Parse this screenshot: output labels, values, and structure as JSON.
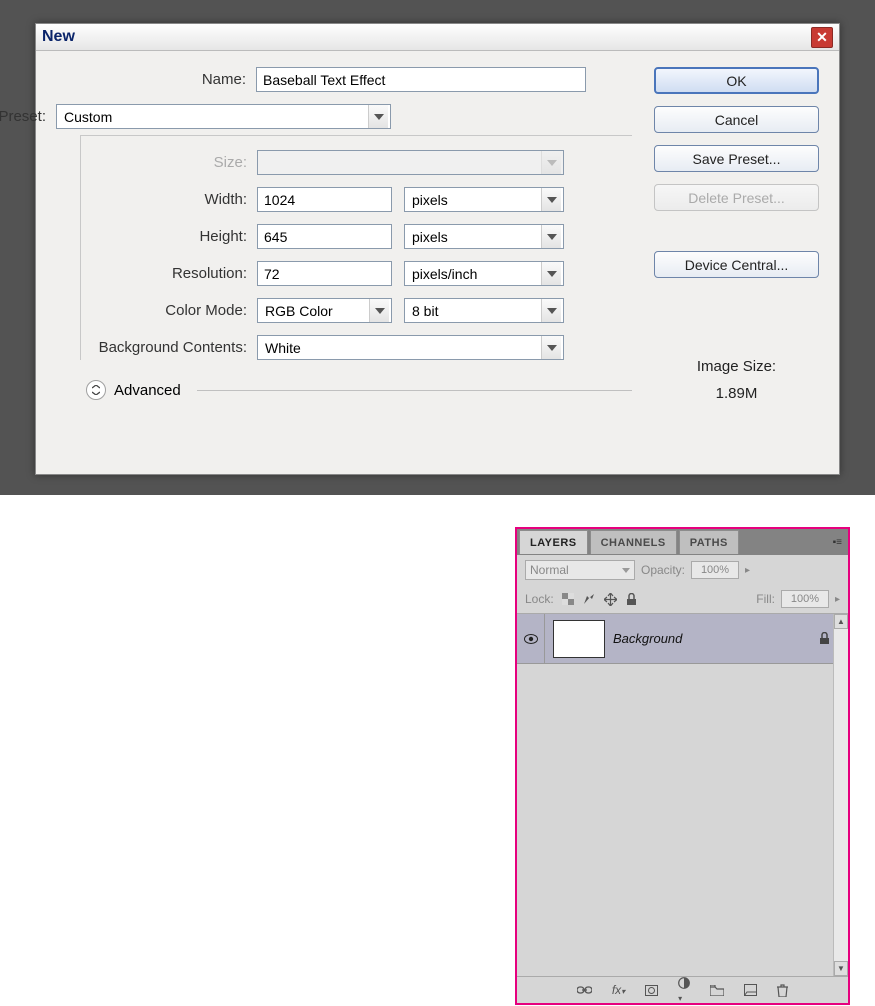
{
  "dialog": {
    "title": "New",
    "name_label": "Name:",
    "name_value": "Baseball Text Effect",
    "preset_label": "Preset:",
    "preset_value": "Custom",
    "size_label": "Size:",
    "size_value": "",
    "width_label": "Width:",
    "width_value": "1024",
    "width_unit": "pixels",
    "height_label": "Height:",
    "height_value": "645",
    "height_unit": "pixels",
    "resolution_label": "Resolution:",
    "resolution_value": "72",
    "resolution_unit": "pixels/inch",
    "color_mode_label": "Color Mode:",
    "color_mode_value": "RGB Color",
    "color_bits": "8 bit",
    "bg_label": "Background Contents:",
    "bg_value": "White",
    "advanced_label": "Advanced",
    "image_size_label": "Image Size:",
    "image_size_value": "1.89M",
    "buttons": {
      "ok": "OK",
      "cancel": "Cancel",
      "save_preset": "Save Preset...",
      "delete_preset": "Delete Preset...",
      "device_central": "Device Central..."
    }
  },
  "layers_panel": {
    "tabs": {
      "layers": "LAYERS",
      "channels": "CHANNELS",
      "paths": "PATHS"
    },
    "blend_mode": "Normal",
    "opacity_label": "Opacity:",
    "opacity_value": "100%",
    "lock_label": "Lock:",
    "fill_label": "Fill:",
    "fill_value": "100%",
    "layer_name": "Background"
  }
}
